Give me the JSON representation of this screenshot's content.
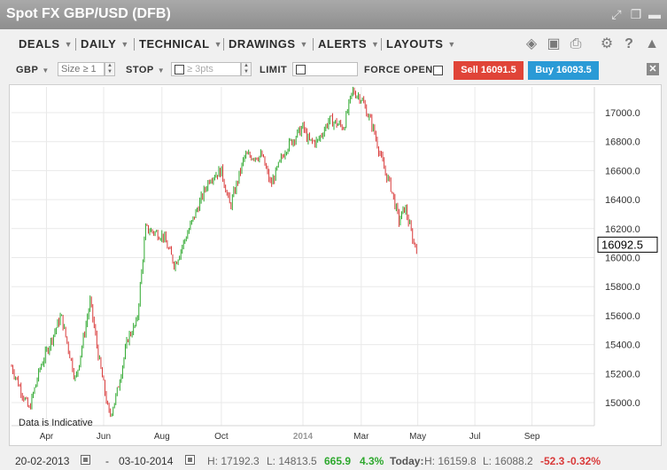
{
  "window": {
    "title": "Spot FX GBP/USD (DFB)"
  },
  "menus": [
    "DEALS",
    "DAILY",
    "TECHNICAL",
    "DRAWINGS",
    "ALERTS",
    "LAYOUTS"
  ],
  "ticket": {
    "currency": "GBP",
    "size_placeholder": "Size ≥ 1",
    "stop_label": "STOP",
    "stop_placeholder": "≥ 3pts",
    "limit_label": "LIMIT",
    "force_open_label": "FORCE OPEN",
    "sell_label": "Sell 16091.5",
    "buy_label": "Buy 16093.5"
  },
  "colors": {
    "sell": "#e04438",
    "buy": "#2a9ad6",
    "up": "#2ea82e",
    "down": "#d93a3a",
    "change_pos": "#2ea82e",
    "change_neg": "#d93a3a"
  },
  "chart_data": {
    "type": "candlestick",
    "ylim": [
      14750,
      17250
    ],
    "yticks": [
      "15000.0",
      "15200.0",
      "15400.0",
      "15600.0",
      "15800.0",
      "16000.0",
      "16200.0",
      "16400.0",
      "16600.0",
      "16800.0",
      "17000.0"
    ],
    "xticks": [
      {
        "label": "Apr",
        "pos": 0.06
      },
      {
        "label": "Jun",
        "pos": 0.158
      },
      {
        "label": "Aug",
        "pos": 0.258
      },
      {
        "label": "Oct",
        "pos": 0.36
      },
      {
        "label": "2014",
        "pos": 0.5,
        "year": true
      },
      {
        "label": "Mar",
        "pos": 0.6
      },
      {
        "label": "May",
        "pos": 0.697
      },
      {
        "label": "Jul",
        "pos": 0.795
      },
      {
        "label": "Sep",
        "pos": 0.893
      }
    ],
    "waypoints": [
      [
        0,
        15250
      ],
      [
        0.03,
        14950
      ],
      [
        0.05,
        15250
      ],
      [
        0.085,
        15600
      ],
      [
        0.11,
        15150
      ],
      [
        0.135,
        15700
      ],
      [
        0.15,
        15300
      ],
      [
        0.168,
        14900
      ],
      [
        0.18,
        15050
      ],
      [
        0.2,
        15450
      ],
      [
        0.215,
        15550
      ],
      [
        0.23,
        16200
      ],
      [
        0.26,
        16150
      ],
      [
        0.28,
        15950
      ],
      [
        0.3,
        16150
      ],
      [
        0.34,
        16550
      ],
      [
        0.36,
        16600
      ],
      [
        0.375,
        16350
      ],
      [
        0.4,
        16700
      ],
      [
        0.43,
        16700
      ],
      [
        0.445,
        16500
      ],
      [
        0.47,
        16750
      ],
      [
        0.5,
        16900
      ],
      [
        0.51,
        16800
      ],
      [
        0.525,
        16800
      ],
      [
        0.545,
        16950
      ],
      [
        0.57,
        16900
      ],
      [
        0.585,
        17150
      ],
      [
        0.6,
        17100
      ],
      [
        0.62,
        16900
      ],
      [
        0.64,
        16600
      ],
      [
        0.65,
        16500
      ],
      [
        0.665,
        16250
      ],
      [
        0.675,
        16350
      ],
      [
        0.69,
        16100
      ],
      [
        0.695,
        16080
      ]
    ],
    "last_price": "16092.5",
    "annotation": "Data is Indicative"
  },
  "status": {
    "start_date": "20-02-2013",
    "dash": "-",
    "end_date": "03-10-2014",
    "high": "H: 17192.3",
    "low": "L: 14813.5",
    "change": "665.9",
    "change_pct": "4.3%",
    "today_label": "Today:",
    "today_high": "H: 16159.8",
    "today_low": "L: 16088.2",
    "today_change": "-52.3",
    "today_change_pct": "-0.32%"
  }
}
